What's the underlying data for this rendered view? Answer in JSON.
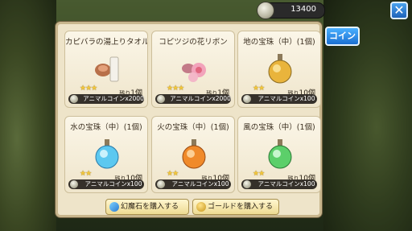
{
  "currency": {
    "icon": "animal-coin-icon",
    "value": "13400"
  },
  "close_label": "✕",
  "tab_label": "コイン",
  "items": [
    {
      "name": "カピバラの湯上りタオル",
      "icon": "towel-icon",
      "stars": 3,
      "stars_text": "★★★",
      "stock_prefix": "残り",
      "stock": "1個",
      "price": "アニマルコインx2000"
    },
    {
      "name": "コピツジの花リボン",
      "icon": "flower-ribbon-icon",
      "stars": 3,
      "stars_text": "★★★",
      "stock_prefix": "残り",
      "stock": "1個",
      "price": "アニマルコインx2000"
    },
    {
      "name": "地の宝珠（中）(1個)",
      "icon": "earth-orb-icon",
      "stars": 2,
      "stars_text": "★★",
      "stock_prefix": "残り",
      "stock": "10個",
      "price": "アニマルコインx100"
    },
    {
      "name": "水の宝珠（中）(1個)",
      "icon": "water-orb-icon",
      "stars": 2,
      "stars_text": "★★",
      "stock_prefix": "残り",
      "stock": "10個",
      "price": "アニマルコインx100"
    },
    {
      "name": "火の宝珠（中）(1個)",
      "icon": "fire-orb-icon",
      "stars": 2,
      "stars_text": "★★",
      "stock_prefix": "残り",
      "stock": "10個",
      "price": "アニマルコインx100"
    },
    {
      "name": "風の宝珠（中）(1個)",
      "icon": "wind-orb-icon",
      "stars": 2,
      "stars_text": "★★",
      "stock_prefix": "残り",
      "stock": "10個",
      "price": "アニマルコインx100"
    }
  ],
  "buttons": {
    "buy_gems": {
      "label": "幻魔石を購入する",
      "icon": "gem-icon"
    },
    "buy_gold": {
      "label": "ゴールドを購入する",
      "icon": "gold-coin-icon"
    }
  }
}
